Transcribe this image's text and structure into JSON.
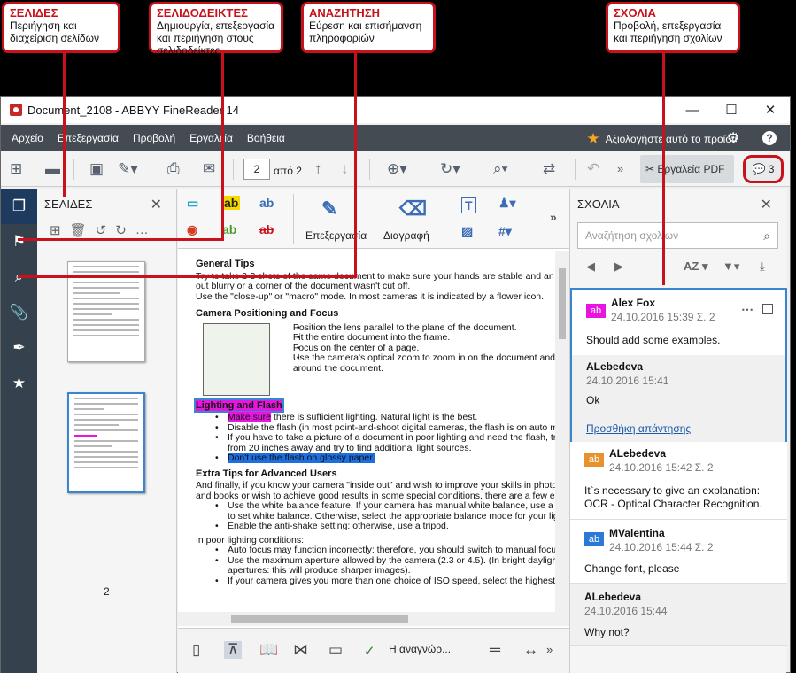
{
  "callouts": [
    {
      "title": "ΣΕΛΙΔΕΣ",
      "desc1": "Περιήγηση και",
      "desc2": "διαχείριση σελίδων",
      "desc3": ""
    },
    {
      "title": "ΣΕΛΙΔΟΔΕΙΚΤΕΣ",
      "desc1": "Δημιουργία, επεξεργασία",
      "desc2": "και περιήγηση στους",
      "desc3": "σελιδοδείκτες"
    },
    {
      "title": "ΑΝΑΖΗΤΗΣΗ",
      "desc1": "Εύρεση και επισήμανση",
      "desc2": "πληροφοριών",
      "desc3": ""
    },
    {
      "title": "ΣΧΟΛΙΑ",
      "desc1": "Προβολή, επεξεργασία",
      "desc2": "και περιήγηση σχολίων",
      "desc3": ""
    }
  ],
  "window": {
    "title": "Document_2108 - ABBYY FineReader 14",
    "controls": {
      "minimize": "—",
      "maximize": "☐",
      "close": "✕"
    }
  },
  "menu": {
    "items": [
      "Αρχείο",
      "Επεξεργασία",
      "Προβολή",
      "Εργαλεία",
      "Βοήθεια"
    ],
    "rate": "Αξιολογήστε αυτό το προϊόν"
  },
  "toolbar": {
    "page_value": "2",
    "page_of": "από 2",
    "pdf_tools": "Εργαλεία PDF",
    "comments_count": "3"
  },
  "pages_panel": {
    "title": "ΣΕΛΙΔΕΣ",
    "thumbs": [
      {
        "number": "1"
      },
      {
        "number": "2"
      }
    ]
  },
  "ribbon": {
    "edit_label": "Επεξεργασία",
    "erase_label": "Διαγραφή"
  },
  "document": {
    "h1": "General Tips",
    "p1a": "Try to take 2-3 shots of the same document to make sure your hands are stable and an ima",
    "p1b": "out blurry or a corner of the document wasn't cut off.",
    "p1c": "Use the \"close-up\" or \"macro\" mode. In most cameras it is indicated by a flower icon.",
    "h2": "Camera Positioning and Focus",
    "b1": "Position the lens parallel to the plane of the document.",
    "b2": "Fit the entire document into the frame.",
    "b3": "Focus on the center of a page.",
    "b4a": "Use the camera's optical zoom to zoom in on the document and",
    "b4b": "around the document.",
    "h3": "Lighting and Flash",
    "l1a": "Make sure",
    "l1b": " there is sufficient lighting. Natural light is the best.",
    "l2": "Disable the flash (in most point-and-shoot digital cameras, the flash is on auto mode",
    "l3a": "If you have to take a picture of a document in poor lighting and need the flash, try to",
    "l3b": "from 20 inches away and try to find additional light sources.",
    "l4": "Don't use the flash on glossy paper.",
    "h4": "Extra Tips for Advanced Users",
    "e1a": "And finally, if you know your camera \"inside out\" and wish to improve your skills in photogra",
    "e1b": "and books or wish to achieve good results in some special conditions, there are a few extra",
    "e2a": "Use the white balance feature. If your camera has manual white balance, use a whi",
    "e2b": "to set white balance. Otherwise, select the appropriate balance mode for your lighti",
    "e3": "Enable the anti-shake setting: otherwise, use a tripod.",
    "e4": "In poor lighting conditions:",
    "e5": "Auto focus may function incorrectly: therefore, you should switch to manual focus.",
    "e6a": "Use the maximum aperture allowed by the camera (2.3 or 4.5). (In bright daylight, u",
    "e6b": "apertures: this will produce sharper images).",
    "e7": "If your camera gives you more than one choice of ISO speed, select the highest ISO"
  },
  "bottom": {
    "recognition": "Η αναγνώρ..."
  },
  "comments_panel": {
    "title": "ΣΧΟΛΙΑ",
    "search_placeholder": "Αναζήτηση σχολίων",
    "sort_label": "AZ",
    "items": [
      {
        "avatar": "ab",
        "name": "Alex Fox",
        "date": "24.10.2016 15:39  Σ. 2",
        "text": "Should add some examples.",
        "reply_name": "ALebedeva",
        "reply_date": "24.10.2016 15:41",
        "reply_text": "Ok",
        "reply_link": "Προσθήκη απάντησης"
      },
      {
        "avatar": "ab",
        "name": "ALebedeva",
        "date": "24.10.2016 15:42  Σ. 2",
        "text1": "It`s necessary to give an explanation:",
        "text2": "OCR - Optical Character Recognition."
      },
      {
        "avatar": "ab",
        "name": "MValentina",
        "date": "24.10.2016 15:44  Σ. 2",
        "text": "Change font, please"
      },
      {
        "name": "ALebedeva",
        "date": "24.10.2016 15:44",
        "text": "Why not?"
      }
    ]
  },
  "colors": {
    "accent_red": "#c8111a",
    "menubar": "#444b52",
    "rail": "#35414d",
    "selection": "#3a85d0",
    "avatar_magenta": "#e815e0",
    "avatar_orange": "#e8922e",
    "avatar_blue": "#2b78d6"
  }
}
